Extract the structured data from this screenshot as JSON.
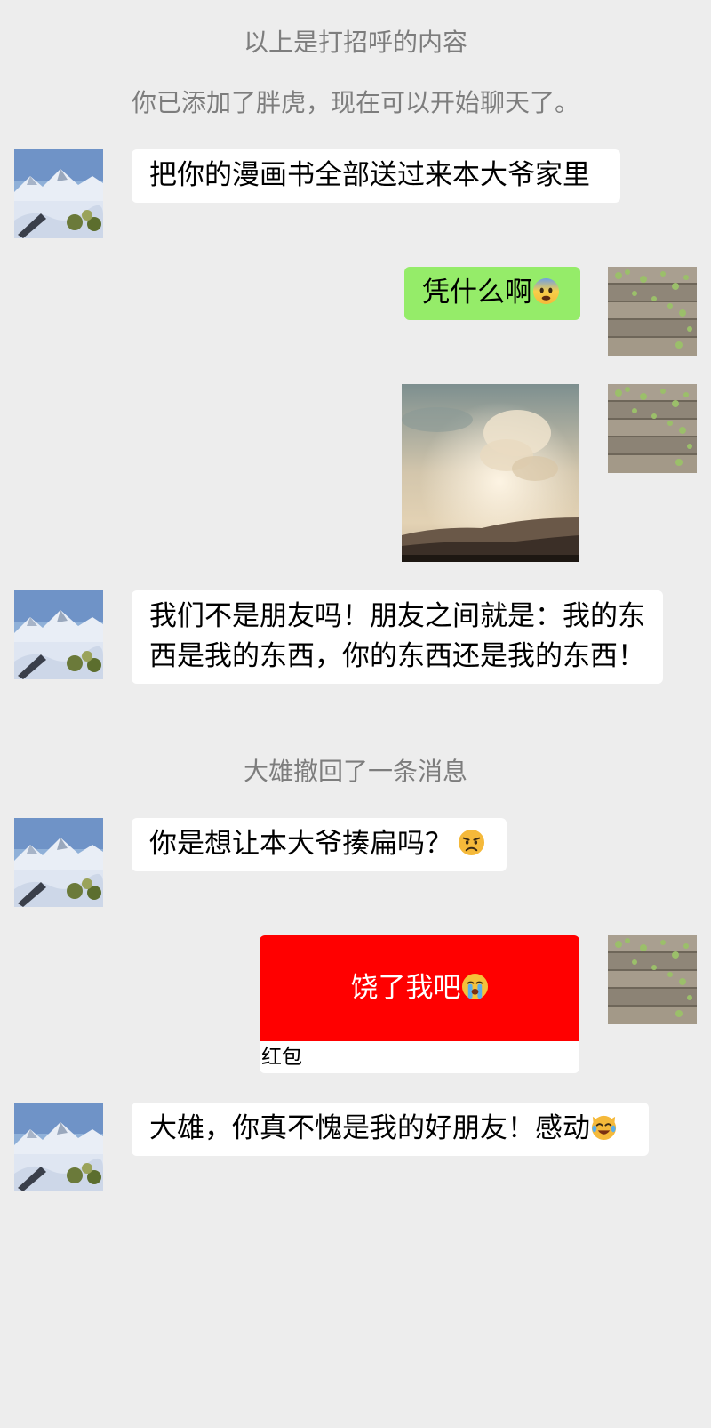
{
  "system_messages": {
    "greeting_notice": "以上是打招呼的内容",
    "added_notice": "你已添加了胖虎，现在可以开始聊天了。",
    "recall_notice": "大雄撤回了一条消息"
  },
  "messages": [
    {
      "sender": "胖虎",
      "side": "left",
      "type": "text",
      "text": "把你的漫画书全部送过来本大爷家里"
    },
    {
      "sender": "me",
      "side": "right",
      "type": "text",
      "text": "凭什么啊",
      "emoji": "fearful-face-icon"
    },
    {
      "sender": "me",
      "side": "right",
      "type": "image",
      "image": "sunset-clouds-photo"
    },
    {
      "sender": "胖虎",
      "side": "left",
      "type": "text",
      "text": "我们不是朋友吗！朋友之间就是：我的东西是我的东西，你的东西还是我的东西！"
    },
    {
      "sender": "胖虎",
      "side": "left",
      "type": "text",
      "text": "你是想让本大爷揍扁吗？",
      "emoji": "angry-face-icon"
    },
    {
      "sender": "me",
      "side": "right",
      "type": "red_packet",
      "text": "饶了我吧",
      "emoji": "loudly-crying-face-icon",
      "label": "红包"
    },
    {
      "sender": "胖虎",
      "side": "left",
      "type": "text",
      "text": "大雄，你真不愧是我的好朋友！感动",
      "emoji": "cat-tears-of-joy-icon"
    }
  ],
  "avatars": {
    "friend": "snowy-mountain-avatar",
    "me": "wooden-fence-vines-avatar"
  },
  "colors": {
    "background": "#ededed",
    "incoming_bubble": "#ffffff",
    "outgoing_bubble": "#95ec69",
    "red_packet": "#ff0000",
    "system_text": "#7d7d7d"
  }
}
